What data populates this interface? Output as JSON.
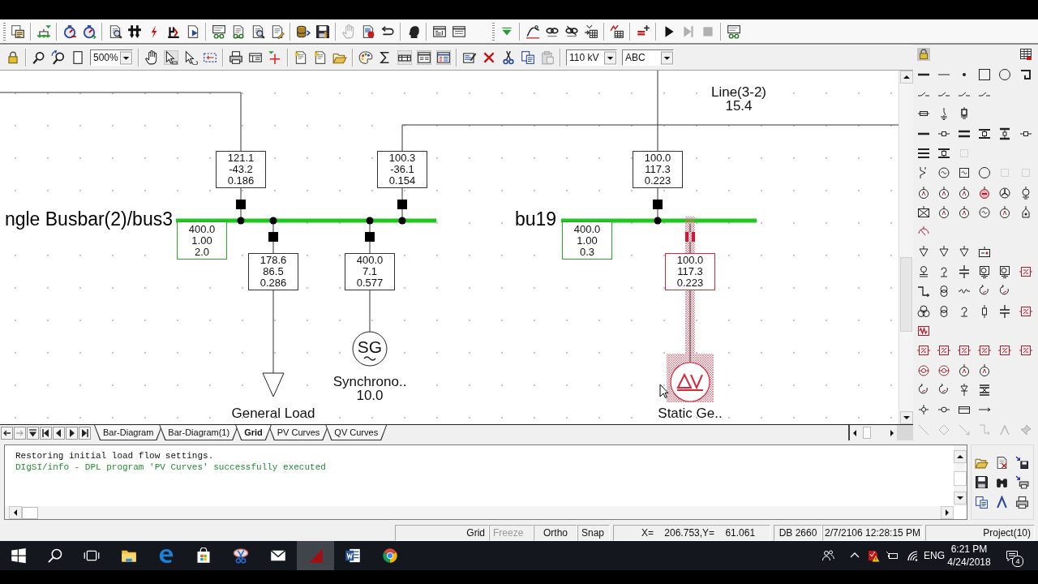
{
  "toolbar": {
    "combos": [
      {
        "value": "500%"
      },
      {
        "value": "110 kV"
      },
      {
        "value": "ABC"
      }
    ]
  },
  "diagram": {
    "line_label": {
      "name": "Line(3-2)",
      "value": "15.4"
    },
    "busbars": [
      {
        "name": "ngle Busbar(2)/bus3",
        "results": [
          "400.0",
          "1.00",
          "2.0"
        ],
        "connections": [
          {
            "kind": "line",
            "results": [
              "121.1",
              "-43.2",
              "0.186"
            ],
            "selected": false
          },
          {
            "kind": "load",
            "name": "General Load",
            "results": [
              "178.6",
              "86.5",
              "0.286"
            ],
            "selected": false
          },
          {
            "kind": "generator",
            "symbol": "SG",
            "name": "Synchrono..",
            "value": "10.0",
            "results": [
              "400.0",
              "7.1",
              "0.577"
            ],
            "selected": false
          },
          {
            "kind": "line",
            "results": [
              "100.3",
              "-36.1",
              "0.154"
            ],
            "selected": false
          }
        ]
      },
      {
        "name": "bu19",
        "results": [
          "400.0",
          "1.00",
          "0.3"
        ],
        "connections": [
          {
            "kind": "line",
            "results": [
              "100.0",
              "117.3",
              "0.223"
            ],
            "selected": false
          },
          {
            "kind": "static_generator",
            "name": "Static Ge..",
            "results": [
              "100.0",
              "117.3",
              "0.223"
            ],
            "selected": true
          }
        ]
      }
    ]
  },
  "tabs": [
    {
      "label": "Bar-Diagram",
      "selected": false
    },
    {
      "label": "Bar-Diagram(1)",
      "selected": false
    },
    {
      "label": "Grid",
      "selected": true
    },
    {
      "label": "PV Curves",
      "selected": false
    },
    {
      "label": "QV Curves",
      "selected": false
    }
  ],
  "output": {
    "lines": [
      {
        "kind": "plain",
        "text": "Restoring initial load flow settings."
      },
      {
        "kind": "info",
        "text": "DIgSI/info - DPL program 'PV Curves' successfully executed"
      }
    ]
  },
  "status_bar": {
    "toggles": [
      {
        "label": "Grid",
        "disabled": false
      },
      {
        "label": "Freeze",
        "disabled": true
      },
      {
        "label": "Ortho",
        "disabled": false
      },
      {
        "label": "Snap",
        "disabled": false
      }
    ],
    "coordinates": "X=    206.753,Y=    61.061",
    "database": "DB 2660",
    "timestamp": "2/7/2106 12:28:15 PM",
    "project": "Project(10)"
  },
  "taskbar": {
    "apps": [
      {
        "selected": false
      },
      {
        "selected": false
      },
      {
        "selected": false
      },
      {
        "selected": false
      },
      {
        "selected": false
      },
      {
        "selected": true
      },
      {
        "selected": false
      },
      {
        "selected": false
      }
    ],
    "language": "ENG",
    "time": "6:21 PM",
    "date": "4/24/2018",
    "notification_count": "4"
  }
}
